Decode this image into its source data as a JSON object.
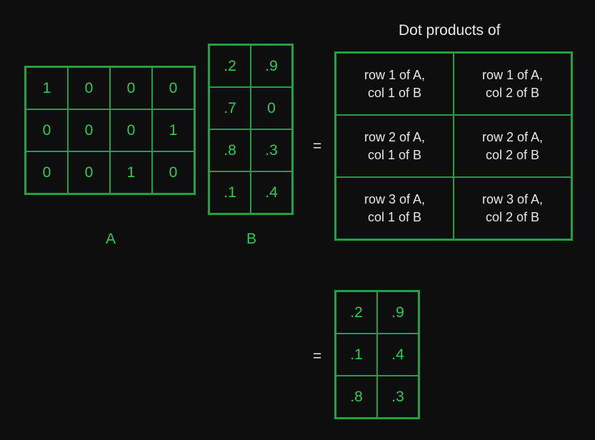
{
  "title": "Dot products of",
  "labels": {
    "A": "A",
    "B": "B",
    "eq": "="
  },
  "matrixA": {
    "rows": 3,
    "cols": 4,
    "cells": [
      "1",
      "0",
      "0",
      "0",
      "0",
      "0",
      "0",
      "1",
      "0",
      "0",
      "1",
      "0"
    ]
  },
  "matrixB": {
    "rows": 4,
    "cols": 2,
    "cells": [
      ".2",
      ".9",
      ".7",
      "0",
      ".8",
      ".3",
      ".1",
      ".4"
    ]
  },
  "resultDesc": {
    "rows": 3,
    "cols": 2,
    "cells": [
      "row 1 of A,\ncol 1 of B",
      "row 1 of A,\ncol 2 of B",
      "row 2 of A,\ncol 1 of B",
      "row 2 of A,\ncol 2 of B",
      "row 3 of A,\ncol 1 of B",
      "row 3 of A,\ncol 2 of B"
    ]
  },
  "resultFinal": {
    "rows": 3,
    "cols": 2,
    "cells": [
      ".2",
      ".9",
      ".1",
      ".4",
      ".8",
      ".3"
    ]
  }
}
